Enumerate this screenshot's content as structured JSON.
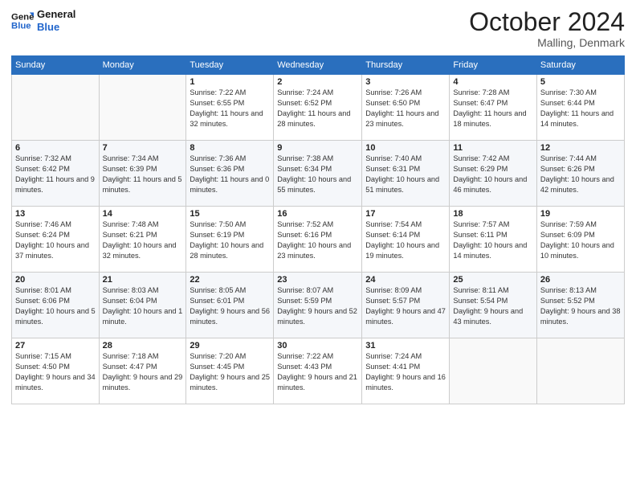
{
  "header": {
    "logo_line1": "General",
    "logo_line2": "Blue",
    "month": "October 2024",
    "location": "Malling, Denmark"
  },
  "days_of_week": [
    "Sunday",
    "Monday",
    "Tuesday",
    "Wednesday",
    "Thursday",
    "Friday",
    "Saturday"
  ],
  "weeks": [
    [
      {
        "day": "",
        "detail": ""
      },
      {
        "day": "",
        "detail": ""
      },
      {
        "day": "1",
        "detail": "Sunrise: 7:22 AM\nSunset: 6:55 PM\nDaylight: 11 hours and 32 minutes."
      },
      {
        "day": "2",
        "detail": "Sunrise: 7:24 AM\nSunset: 6:52 PM\nDaylight: 11 hours and 28 minutes."
      },
      {
        "day": "3",
        "detail": "Sunrise: 7:26 AM\nSunset: 6:50 PM\nDaylight: 11 hours and 23 minutes."
      },
      {
        "day": "4",
        "detail": "Sunrise: 7:28 AM\nSunset: 6:47 PM\nDaylight: 11 hours and 18 minutes."
      },
      {
        "day": "5",
        "detail": "Sunrise: 7:30 AM\nSunset: 6:44 PM\nDaylight: 11 hours and 14 minutes."
      }
    ],
    [
      {
        "day": "6",
        "detail": "Sunrise: 7:32 AM\nSunset: 6:42 PM\nDaylight: 11 hours and 9 minutes."
      },
      {
        "day": "7",
        "detail": "Sunrise: 7:34 AM\nSunset: 6:39 PM\nDaylight: 11 hours and 5 minutes."
      },
      {
        "day": "8",
        "detail": "Sunrise: 7:36 AM\nSunset: 6:36 PM\nDaylight: 11 hours and 0 minutes."
      },
      {
        "day": "9",
        "detail": "Sunrise: 7:38 AM\nSunset: 6:34 PM\nDaylight: 10 hours and 55 minutes."
      },
      {
        "day": "10",
        "detail": "Sunrise: 7:40 AM\nSunset: 6:31 PM\nDaylight: 10 hours and 51 minutes."
      },
      {
        "day": "11",
        "detail": "Sunrise: 7:42 AM\nSunset: 6:29 PM\nDaylight: 10 hours and 46 minutes."
      },
      {
        "day": "12",
        "detail": "Sunrise: 7:44 AM\nSunset: 6:26 PM\nDaylight: 10 hours and 42 minutes."
      }
    ],
    [
      {
        "day": "13",
        "detail": "Sunrise: 7:46 AM\nSunset: 6:24 PM\nDaylight: 10 hours and 37 minutes."
      },
      {
        "day": "14",
        "detail": "Sunrise: 7:48 AM\nSunset: 6:21 PM\nDaylight: 10 hours and 32 minutes."
      },
      {
        "day": "15",
        "detail": "Sunrise: 7:50 AM\nSunset: 6:19 PM\nDaylight: 10 hours and 28 minutes."
      },
      {
        "day": "16",
        "detail": "Sunrise: 7:52 AM\nSunset: 6:16 PM\nDaylight: 10 hours and 23 minutes."
      },
      {
        "day": "17",
        "detail": "Sunrise: 7:54 AM\nSunset: 6:14 PM\nDaylight: 10 hours and 19 minutes."
      },
      {
        "day": "18",
        "detail": "Sunrise: 7:57 AM\nSunset: 6:11 PM\nDaylight: 10 hours and 14 minutes."
      },
      {
        "day": "19",
        "detail": "Sunrise: 7:59 AM\nSunset: 6:09 PM\nDaylight: 10 hours and 10 minutes."
      }
    ],
    [
      {
        "day": "20",
        "detail": "Sunrise: 8:01 AM\nSunset: 6:06 PM\nDaylight: 10 hours and 5 minutes."
      },
      {
        "day": "21",
        "detail": "Sunrise: 8:03 AM\nSunset: 6:04 PM\nDaylight: 10 hours and 1 minute."
      },
      {
        "day": "22",
        "detail": "Sunrise: 8:05 AM\nSunset: 6:01 PM\nDaylight: 9 hours and 56 minutes."
      },
      {
        "day": "23",
        "detail": "Sunrise: 8:07 AM\nSunset: 5:59 PM\nDaylight: 9 hours and 52 minutes."
      },
      {
        "day": "24",
        "detail": "Sunrise: 8:09 AM\nSunset: 5:57 PM\nDaylight: 9 hours and 47 minutes."
      },
      {
        "day": "25",
        "detail": "Sunrise: 8:11 AM\nSunset: 5:54 PM\nDaylight: 9 hours and 43 minutes."
      },
      {
        "day": "26",
        "detail": "Sunrise: 8:13 AM\nSunset: 5:52 PM\nDaylight: 9 hours and 38 minutes."
      }
    ],
    [
      {
        "day": "27",
        "detail": "Sunrise: 7:15 AM\nSunset: 4:50 PM\nDaylight: 9 hours and 34 minutes."
      },
      {
        "day": "28",
        "detail": "Sunrise: 7:18 AM\nSunset: 4:47 PM\nDaylight: 9 hours and 29 minutes."
      },
      {
        "day": "29",
        "detail": "Sunrise: 7:20 AM\nSunset: 4:45 PM\nDaylight: 9 hours and 25 minutes."
      },
      {
        "day": "30",
        "detail": "Sunrise: 7:22 AM\nSunset: 4:43 PM\nDaylight: 9 hours and 21 minutes."
      },
      {
        "day": "31",
        "detail": "Sunrise: 7:24 AM\nSunset: 4:41 PM\nDaylight: 9 hours and 16 minutes."
      },
      {
        "day": "",
        "detail": ""
      },
      {
        "day": "",
        "detail": ""
      }
    ]
  ]
}
